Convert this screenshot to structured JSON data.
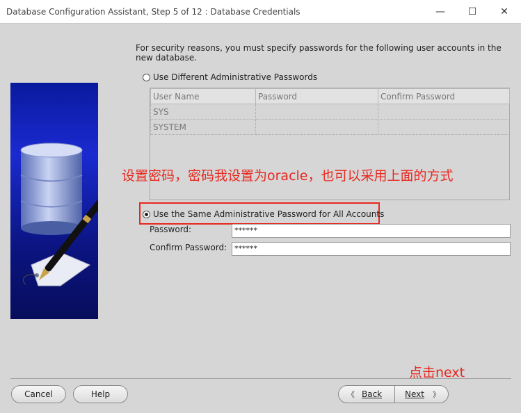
{
  "window": {
    "title": "Database Configuration Assistant, Step 5 of 12 : Database Credentials",
    "minimize_glyph": "—",
    "maximize_glyph": "☐",
    "close_glyph": "✕"
  },
  "intro_text": "For security reasons, you must specify passwords for the following user accounts in the new database.",
  "option_different": {
    "label": "Use Different Administrative Passwords",
    "selected": false
  },
  "accounts_table": {
    "headers": [
      "User Name",
      "Password",
      "Confirm Password"
    ],
    "rows": [
      {
        "user": "SYS",
        "password": "",
        "confirm": ""
      },
      {
        "user": "SYSTEM",
        "password": "",
        "confirm": ""
      }
    ]
  },
  "annotation_text": "设置密码，密码我设置为oracle，也可以采用上面的方式",
  "option_same": {
    "label": "Use the Same Administrative Password for All Accounts",
    "selected": true
  },
  "password_field": {
    "label": "Password:",
    "value": "******"
  },
  "confirm_field": {
    "label": "Confirm Password:",
    "value": "******"
  },
  "next_annotation": "点击next",
  "buttons": {
    "cancel": "Cancel",
    "help": "Help",
    "back": "Back",
    "next": "Next"
  },
  "colors": {
    "annotation_red": "#e8281f",
    "side_panel_blue": "#0a1a9e",
    "background": "#d6d6d6"
  }
}
